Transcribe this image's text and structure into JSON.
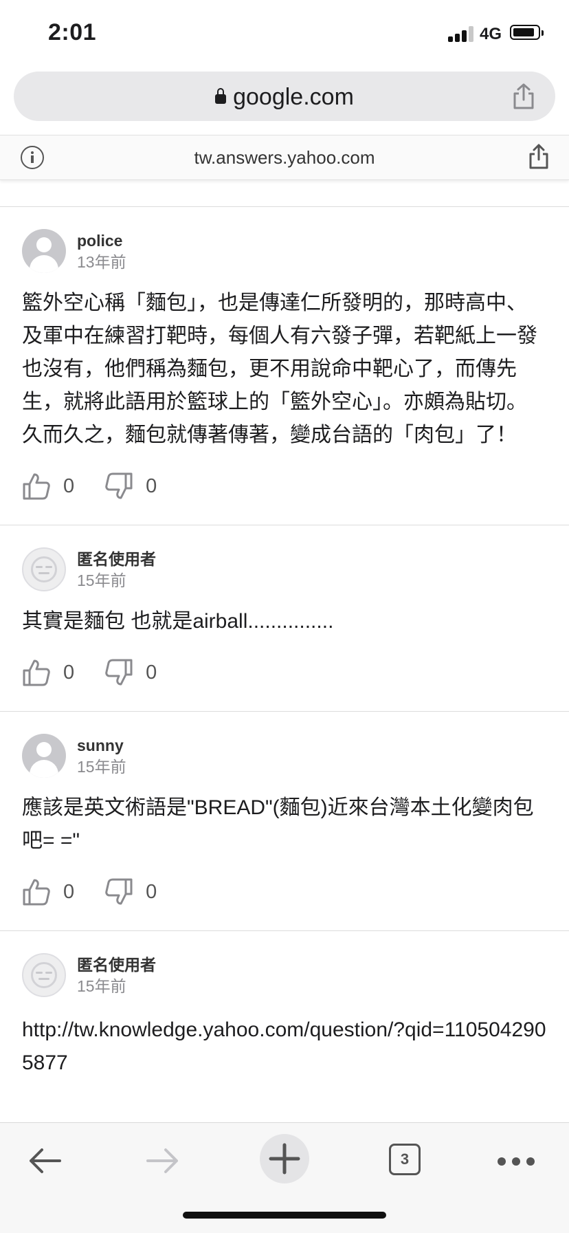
{
  "status_bar": {
    "time": "2:01",
    "network": "4G"
  },
  "browser": {
    "url": "google.com",
    "amp_domain": "tw.answers.yahoo.com",
    "open_tabs": "3"
  },
  "answers": [
    {
      "author": "police",
      "time": "13年前",
      "avatar": "user-silhouette",
      "text": "籃外空心稱「麵包」，也是傳達仁所發明的，那時高中、及軍中在練習打靶時，每個人有六發子彈，若靶紙上一發也沒有，他們稱為麵包，更不用說命中靶心了，而傳先生，就將此語用於籃球上的「籃外空心」。亦頗為貼切。久而久之，麵包就傳著傳著，變成台語的「肉包」了！",
      "likes": "0",
      "dislikes": "0"
    },
    {
      "author": "匿名使用者",
      "time": "15年前",
      "avatar": "anonymous",
      "text": "其實是麵包 也就是airball...............",
      "likes": "0",
      "dislikes": "0"
    },
    {
      "author": "sunny",
      "time": "15年前",
      "avatar": "user-silhouette",
      "text": "應該是英文術語是\"BREAD\"(麵包)近來台灣本土化變肉包吧= =\"",
      "likes": "0",
      "dislikes": "0"
    },
    {
      "author": "匿名使用者",
      "time": "15年前",
      "avatar": "anonymous",
      "text": "http://tw.knowledge.yahoo.com/question/?qid=1105042905877",
      "likes": "",
      "dislikes": ""
    }
  ]
}
